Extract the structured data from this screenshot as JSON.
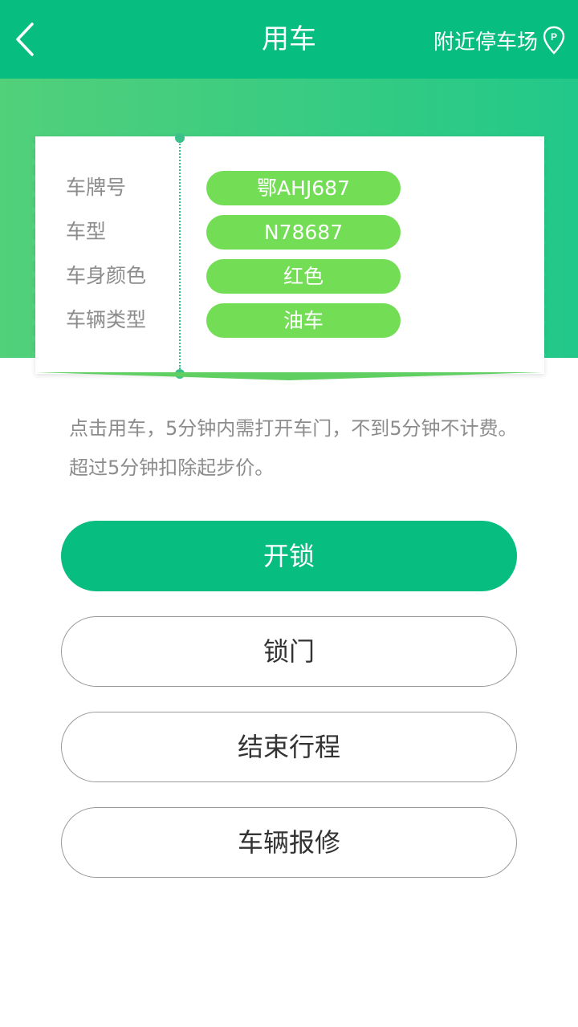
{
  "header": {
    "title": "用车",
    "nearby_label": "附近停车场",
    "back_icon": "chevron-left-icon",
    "nearby_icon": "parking-pin-icon",
    "color": "#07bd7f"
  },
  "banner": {
    "gradient_start": "#52d07a",
    "gradient_end": "#22c889"
  },
  "vehicle": {
    "rows": [
      {
        "label": "车牌号",
        "value": "鄂AHJ687"
      },
      {
        "label": "车型",
        "value": "N78687"
      },
      {
        "label": "车身颜色",
        "value": "红色"
      },
      {
        "label": "车辆类型",
        "value": "油车"
      }
    ],
    "pill_color": "#72dd55"
  },
  "notice": "点击用车，5分钟内需打开车门，不到5分钟不计费。超过5分钟扣除起步价。",
  "actions": {
    "unlock": "开锁",
    "lock": "锁门",
    "end_trip": "结束行程",
    "report_repair": "车辆报修"
  }
}
